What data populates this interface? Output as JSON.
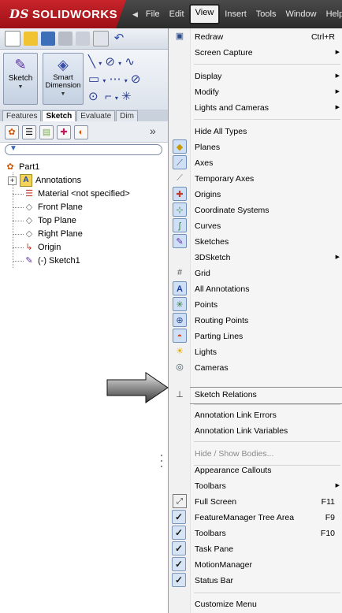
{
  "app": {
    "brand": "SOLIDWORKS",
    "brand_prefix": "DS",
    "colors": {
      "brand_red": "#c8242b",
      "menu_highlight_outline": "#222222",
      "check_bg": "#d6e4f5"
    }
  },
  "menubar": {
    "items": [
      {
        "label": "File"
      },
      {
        "label": "Edit"
      },
      {
        "label": "View",
        "active": true
      },
      {
        "label": "Insert"
      },
      {
        "label": "Tools"
      },
      {
        "label": "Window"
      },
      {
        "label": "Help"
      }
    ]
  },
  "command_manager": {
    "sketch_label": "Sketch",
    "smart_dimension_label": "Smart Dimension",
    "tabs": [
      {
        "label": "Features"
      },
      {
        "label": "Sketch",
        "active": true
      },
      {
        "label": "Evaluate"
      },
      {
        "label": "Dim"
      }
    ]
  },
  "feature_tree": {
    "items": [
      {
        "label": "Part1",
        "icon": "part-icon"
      },
      {
        "label": "Annotations",
        "icon": "annotations-icon"
      },
      {
        "label": "Material <not specified>",
        "icon": "material-icon"
      },
      {
        "label": "Front Plane",
        "icon": "plane-icon"
      },
      {
        "label": "Top Plane",
        "icon": "plane-icon"
      },
      {
        "label": "Right Plane",
        "icon": "plane-icon"
      },
      {
        "label": "Origin",
        "icon": "origin-icon"
      },
      {
        "label": "(-) Sketch1",
        "icon": "sketch-icon"
      }
    ]
  },
  "view_menu": {
    "items": [
      {
        "label": "Redraw",
        "shortcut": "Ctrl+R",
        "icon": "redraw-icon"
      },
      {
        "label": "Screen Capture",
        "submenu": true
      },
      {
        "label": "Display",
        "submenu": true
      },
      {
        "label": "Modify",
        "submenu": true
      },
      {
        "label": "Lights and Cameras",
        "submenu": true
      },
      {
        "label": "Hide All Types"
      },
      {
        "label": "Planes",
        "icon": "planes-icon",
        "toggled": true
      },
      {
        "label": "Axes",
        "icon": "axes-icon",
        "toggled": true
      },
      {
        "label": "Temporary Axes",
        "icon": "temporary-axes-icon"
      },
      {
        "label": "Origins",
        "icon": "origins-icon",
        "toggled": true
      },
      {
        "label": "Coordinate Systems",
        "icon": "coordinate-systems-icon",
        "toggled": true
      },
      {
        "label": "Curves",
        "icon": "curves-icon",
        "toggled": true
      },
      {
        "label": "Sketches",
        "icon": "sketches-icon",
        "toggled": true
      },
      {
        "label": "3DSketch",
        "submenu": true
      },
      {
        "label": "Grid",
        "icon": "grid-icon"
      },
      {
        "label": "All Annotations",
        "icon": "all-annotations-icon",
        "toggled": true
      },
      {
        "label": "Points",
        "icon": "points-icon",
        "toggled": true
      },
      {
        "label": "Routing Points",
        "icon": "routing-points-icon",
        "toggled": true
      },
      {
        "label": "Parting Lines",
        "icon": "parting-lines-icon",
        "toggled": true
      },
      {
        "label": "Lights",
        "icon": "lights-icon"
      },
      {
        "label": "Cameras",
        "icon": "cameras-icon"
      },
      {
        "label": "Sketch Relations",
        "icon": "sketch-relations-icon",
        "highlighted": true
      },
      {
        "label": "Annotation Link Errors"
      },
      {
        "label": "Annotation Link Variables"
      },
      {
        "label": "Hide / Show Bodies...",
        "disabled": true
      },
      {
        "label": "Appearance Callouts"
      },
      {
        "label": "Toolbars",
        "submenu": true
      },
      {
        "label": "Full Screen",
        "shortcut": "F11",
        "icon": "full-screen-icon"
      },
      {
        "label": "FeatureManager Tree Area",
        "shortcut": "F9",
        "checked": true
      },
      {
        "label": "Toolbars",
        "shortcut": "F10",
        "checked": true
      },
      {
        "label": "Task Pane",
        "checked": true
      },
      {
        "label": "MotionManager",
        "checked": true
      },
      {
        "label": "Status Bar",
        "checked": true
      },
      {
        "label": "Customize Menu"
      }
    ]
  }
}
